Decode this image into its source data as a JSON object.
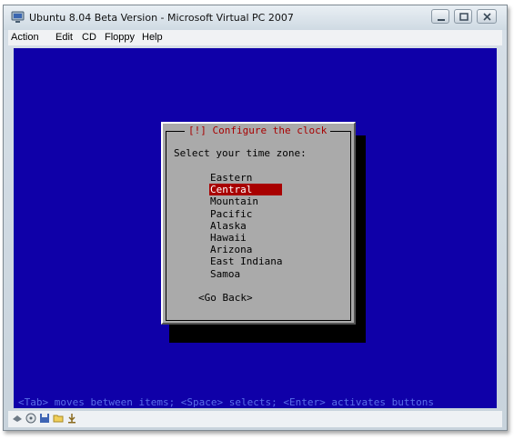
{
  "window": {
    "title": "Ubuntu 8.04 Beta Version - Microsoft Virtual PC 2007"
  },
  "menu": {
    "action": "Action",
    "edit": "Edit",
    "cd": "CD",
    "floppy": "Floppy",
    "help": "Help"
  },
  "dialog": {
    "title": "[!] Configure the clock",
    "prompt": "Select your time zone:",
    "options": [
      "Eastern",
      "Central",
      "Mountain",
      "Pacific",
      "Alaska",
      "Hawaii",
      "Arizona",
      "East Indiana",
      "Samoa"
    ],
    "selected": "Central",
    "go_back": "<Go Back>"
  },
  "status_line": "<Tab> moves between items; <Space> selects; <Enter> activates buttons",
  "statusbar_icons": [
    "network-icon",
    "cd-icon",
    "floppy-icon",
    "shared-folder-icon",
    "usb-icon"
  ],
  "colors": {
    "screen_bg": "#0f00a8",
    "dialog_bg": "#aaaaaa",
    "title_red": "#a80000",
    "hint_text": "#5a6fe8"
  }
}
